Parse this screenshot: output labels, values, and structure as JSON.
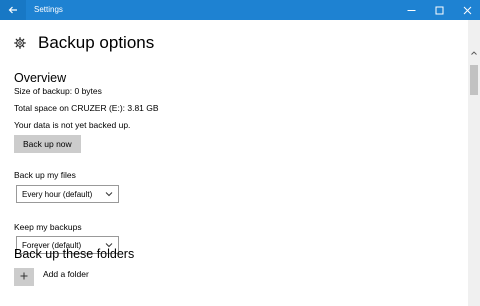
{
  "window": {
    "title": "Settings"
  },
  "header": {
    "title": "Backup options"
  },
  "overview": {
    "heading": "Overview",
    "size_line": "Size of backup: 0 bytes",
    "total_line": "Total space on CRUZER (E:): 3.81 GB",
    "status_line": "Your data is not yet backed up.",
    "backup_button": "Back up now"
  },
  "frequency": {
    "label": "Back up my files",
    "selected": "Every hour (default)"
  },
  "retention": {
    "label": "Keep my backups",
    "selected": "Forever (default)"
  },
  "folders": {
    "heading": "Back up these folders",
    "add_label": "Add a folder"
  },
  "icons": {
    "back": "back-arrow-icon",
    "minimize": "minimize-icon",
    "maximize": "maximize-icon",
    "close": "close-icon",
    "settings": "gear-icon",
    "dropdown": "chevron-down-icon",
    "add": "plus-icon"
  },
  "colors": {
    "titlebar": "#1e82d2",
    "button_bg": "#cccccc"
  }
}
